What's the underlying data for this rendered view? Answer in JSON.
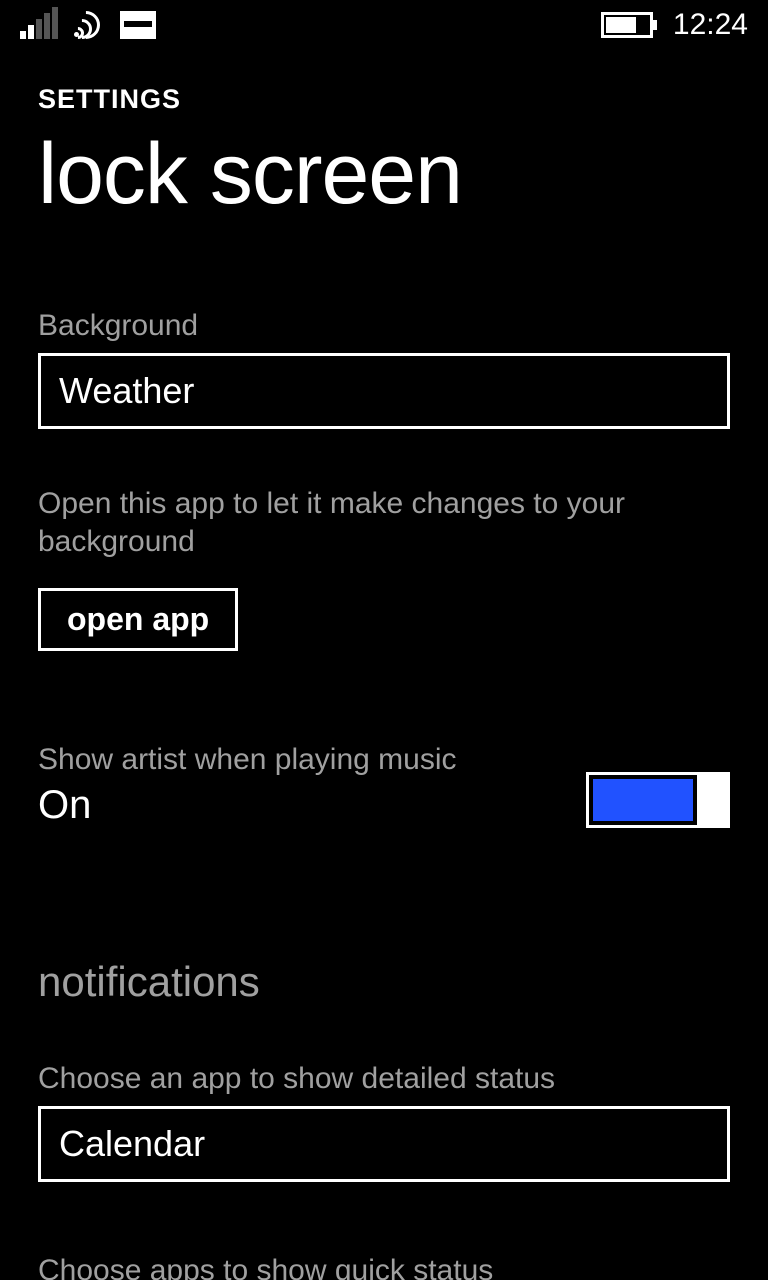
{
  "status": {
    "time": "12:24"
  },
  "header": {
    "app": "SETTINGS",
    "page": "lock screen"
  },
  "background": {
    "label": "Background",
    "selected": "Weather",
    "hint": "Open this app to let it make changes to your background",
    "open_btn": "open app"
  },
  "artist_toggle": {
    "label": "Show artist when playing music",
    "state": "On",
    "on": true,
    "accent": "#2152ff"
  },
  "notifications": {
    "heading": "notifications",
    "detailed_label": "Choose an app to show detailed status",
    "detailed_selected": "Calendar",
    "quick_label": "Choose apps to show quick status"
  }
}
